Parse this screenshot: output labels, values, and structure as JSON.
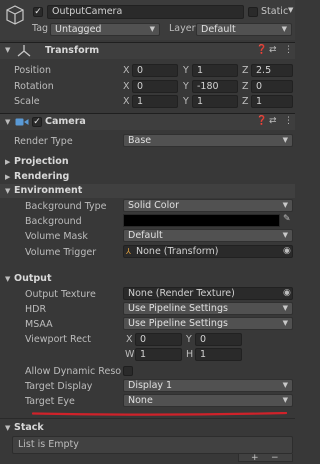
{
  "header": {
    "object_name": "OutputCamera",
    "static_label": "Static",
    "tag_label": "Tag",
    "tag_value": "Untagged",
    "layer_label": "Layer",
    "layer_value": "Default"
  },
  "transform": {
    "title": "Transform",
    "rows": [
      {
        "label": "Position",
        "x": "0",
        "y": "1",
        "z": "2.5"
      },
      {
        "label": "Rotation",
        "x": "0",
        "y": "-180",
        "z": "0"
      },
      {
        "label": "Scale",
        "x": "1",
        "y": "1",
        "z": "1"
      }
    ],
    "axis": {
      "x": "X",
      "y": "Y",
      "z": "Z"
    }
  },
  "camera": {
    "title": "Camera",
    "render_type_label": "Render Type",
    "render_type_value": "Base",
    "projection": "Projection",
    "rendering": "Rendering",
    "environment": "Environment",
    "env": {
      "bg_type_label": "Background Type",
      "bg_type_value": "Solid Color",
      "background_label": "Background",
      "background_color": "#000000",
      "volume_mask_label": "Volume Mask",
      "volume_mask_value": "Default",
      "volume_trigger_label": "Volume Trigger",
      "volume_trigger_value": "None (Transform)"
    },
    "output": "Output",
    "out": {
      "texture_label": "Output Texture",
      "texture_value": "None (Render Texture)",
      "hdr_label": "HDR",
      "hdr_value": "Use Pipeline Settings",
      "msaa_label": "MSAA",
      "msaa_value": "Use Pipeline Settings",
      "viewport_label": "Viewport Rect",
      "vp": {
        "x_label": "X",
        "x": "0",
        "y_label": "Y",
        "y": "0",
        "w_label": "W",
        "w": "1",
        "h_label": "H",
        "h": "1"
      },
      "dynres_label": "Allow Dynamic Resolu",
      "target_display_label": "Target Display",
      "target_display_value": "Display 1",
      "target_eye_label": "Target Eye",
      "target_eye_value": "None"
    },
    "stack": "Stack",
    "stack_empty": "List is Empty",
    "plus": "+",
    "minus": "−"
  },
  "colors": {
    "underline": "#d0222a",
    "accent_blue": "#5a9ad6"
  },
  "icons": {
    "object": "cube-icon",
    "transform": "transform-axes-icon",
    "camera": "camera-icon",
    "help": "help-icon",
    "presets": "presets-icon",
    "menu": "kebab-menu-icon",
    "target": "object-picker-icon",
    "eyedropper": "eyedropper-icon"
  }
}
